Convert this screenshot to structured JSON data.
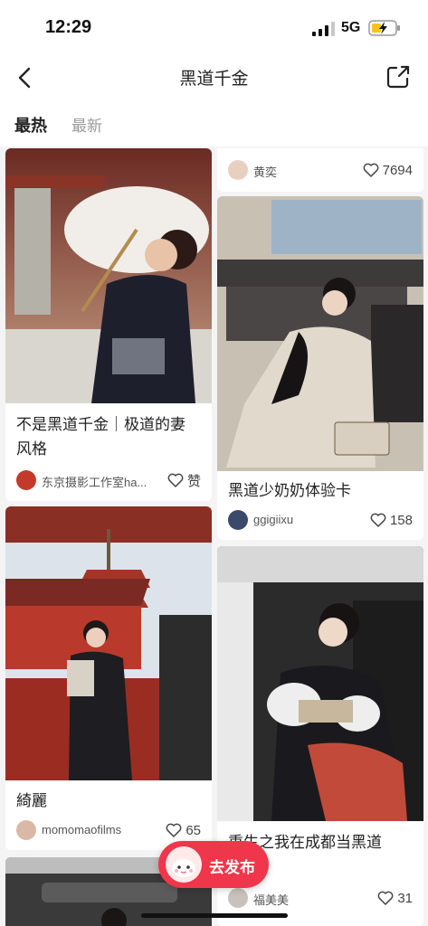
{
  "status_bar": {
    "time": "12:29",
    "network": "5G"
  },
  "nav": {
    "title": "黑道千金"
  },
  "tabs": [
    {
      "label": "最热"
    },
    {
      "label": "最新"
    }
  ],
  "posts": [
    {
      "title_line1": "不是黑道千金｜极道的妻",
      "title_line2": "风格",
      "author": "东京摄影工作室ha...",
      "likes": "赞"
    },
    {
      "author": "黄奕",
      "likes": "7694"
    },
    {
      "title": "黑道少奶奶体验卡",
      "author": "ggigiixu",
      "likes": "158"
    },
    {
      "title": "綺麗",
      "author": "momomaofilms",
      "likes": "65"
    },
    {
      "title": "重生之我在成都当黑道",
      "author": "福美美",
      "likes": "31"
    }
  ],
  "publish": {
    "label": "去发布"
  },
  "colors": {
    "accent": "#f0364a"
  }
}
